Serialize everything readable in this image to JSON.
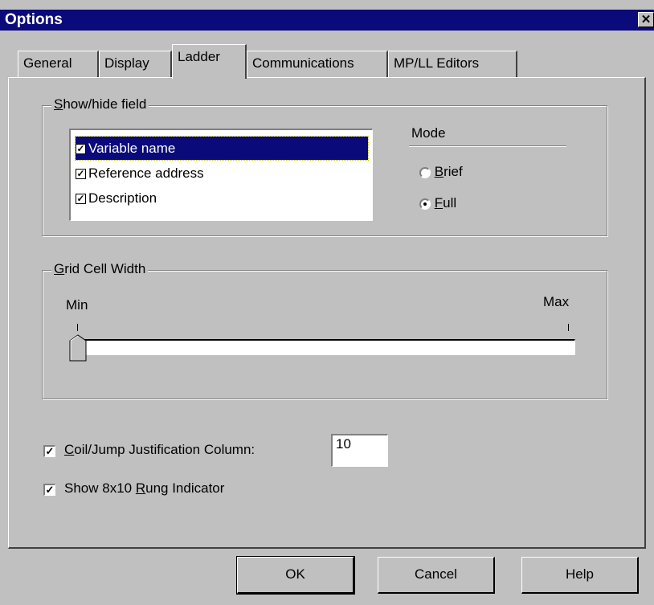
{
  "window": {
    "title": "Options",
    "close_glyph": "✕"
  },
  "tabs": [
    {
      "label": "General",
      "active": false
    },
    {
      "label": "Display",
      "active": false
    },
    {
      "label": "Ladder",
      "active": true
    },
    {
      "label": "Communications",
      "active": false
    },
    {
      "label": "MP/LL Editors",
      "active": false
    }
  ],
  "show_hide": {
    "legend_hot": "S",
    "legend_rest": "how/hide field",
    "items": [
      {
        "label": "Variable name",
        "checked": true,
        "selected": true
      },
      {
        "label": "Reference address",
        "checked": true,
        "selected": false
      },
      {
        "label": "Description",
        "checked": true,
        "selected": false
      }
    ]
  },
  "mode": {
    "label": "Mode",
    "options": [
      {
        "hot": "B",
        "rest": "rief",
        "selected": false
      },
      {
        "hot": "F",
        "rest": "ull",
        "selected": true
      }
    ]
  },
  "grid": {
    "legend_hot": "G",
    "legend_rest": "rid Cell Width",
    "min_label": "Min",
    "max_label": "Max",
    "value_fraction": 0.0
  },
  "options": {
    "coil_pre": "",
    "coil_hot": "C",
    "coil_rest": "oil/Jump Justification Column:",
    "coil_checked": true,
    "coil_value": "10",
    "rung_pre": "Show 8x10 ",
    "rung_hot": "R",
    "rung_rest": "ung Indicator",
    "rung_checked": true
  },
  "buttons": {
    "ok": "OK",
    "cancel": "Cancel",
    "help": "Help"
  },
  "colors": {
    "titlebar": "#0a0a7a",
    "face": "#c0c0c0",
    "selection": "#0a0a7a"
  },
  "icons": {
    "checkmark": "check-icon",
    "close": "close-icon"
  }
}
